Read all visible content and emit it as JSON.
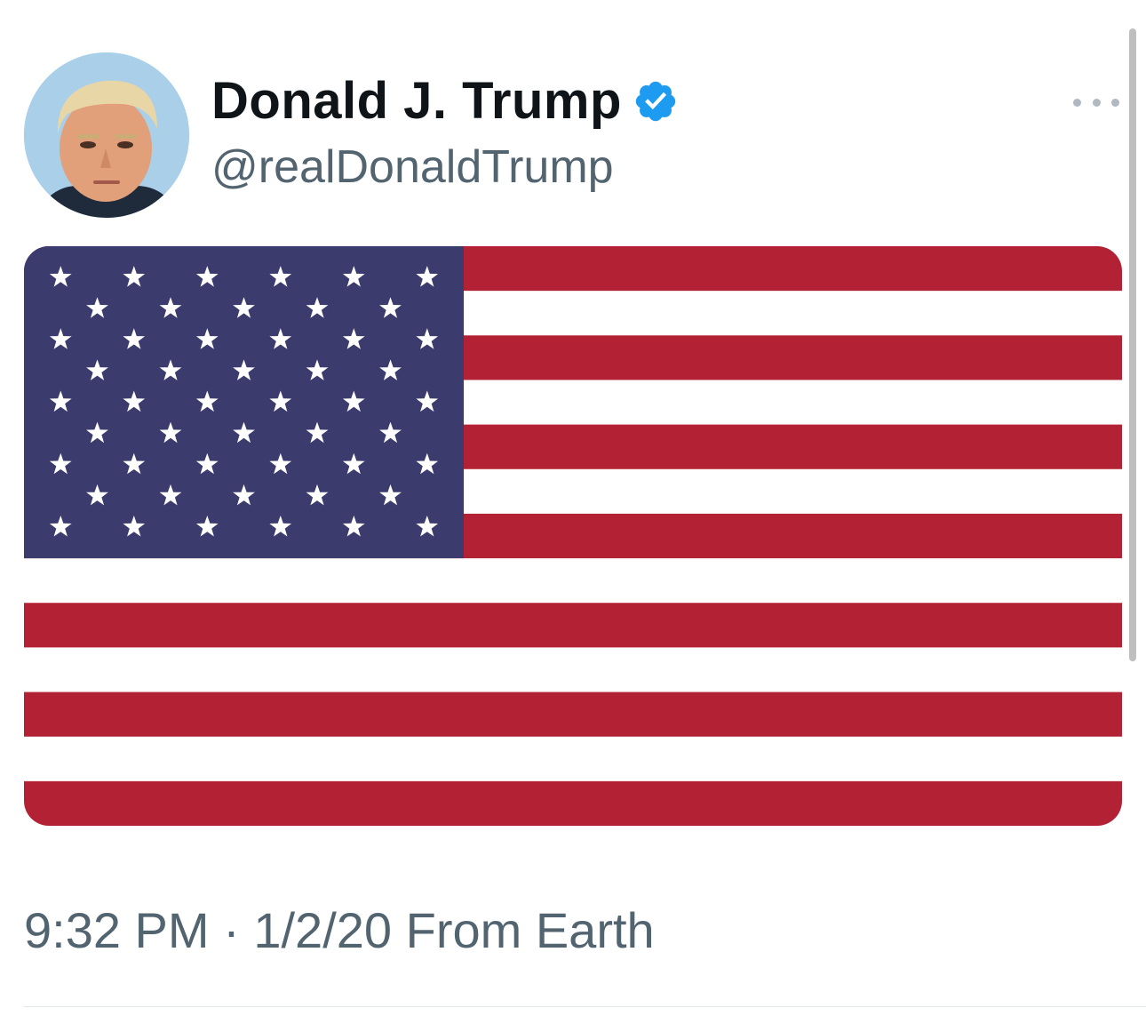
{
  "tweet": {
    "author": {
      "display_name": "Donald J. Trump",
      "handle": "@realDonaldTrump",
      "verified": true,
      "verified_color": "#1d9bf0",
      "avatar_icon": "profile-photo"
    },
    "more_icon": "ellipsis-icon",
    "media": {
      "kind": "image",
      "depicts": "american-flag",
      "colors": {
        "red": "#b22234",
        "white": "#ffffff",
        "blue": "#3c3b6e"
      }
    },
    "meta": {
      "time": "9:32 PM",
      "separator": "·",
      "date": "1/2/20",
      "source": "From Earth"
    }
  }
}
